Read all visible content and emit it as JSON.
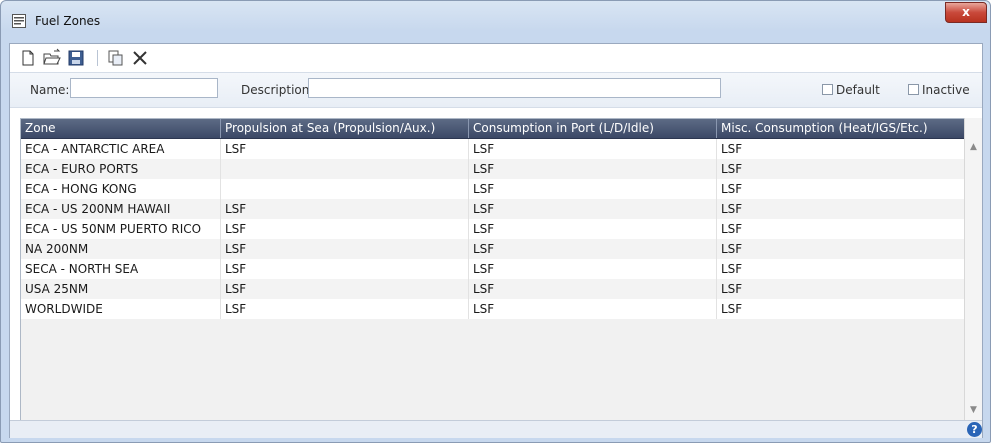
{
  "window": {
    "title": "Fuel Zones",
    "close_label": "x"
  },
  "toolbar": {
    "buttons": [
      {
        "name": "new-document"
      },
      {
        "name": "open-folder"
      },
      {
        "name": "save"
      },
      {
        "name": "copy"
      },
      {
        "name": "delete"
      }
    ]
  },
  "form": {
    "name_label": "Name:",
    "name_value": "",
    "description_label": "Description:",
    "description_value": "",
    "default_label": "Default",
    "inactive_label": "Inactive",
    "default_checked": false,
    "inactive_checked": false
  },
  "grid": {
    "columns": [
      "Zone",
      "Propulsion at Sea (Propulsion/Aux.)",
      "Consumption in Port (L/D/Idle)",
      "Misc. Consumption (Heat/IGS/Etc.)"
    ],
    "rows": [
      [
        "ECA - ANTARCTIC AREA",
        "LSF",
        "LSF",
        "LSF"
      ],
      [
        "ECA - EURO PORTS",
        "",
        "LSF",
        "LSF"
      ],
      [
        "ECA - HONG KONG",
        "",
        "LSF",
        "LSF"
      ],
      [
        "ECA - US 200NM HAWAII",
        "LSF",
        "LSF",
        "LSF"
      ],
      [
        "ECA - US 50NM PUERTO RICO",
        "LSF",
        "LSF",
        "LSF"
      ],
      [
        "NA 200NM",
        "LSF",
        "LSF",
        "LSF"
      ],
      [
        "SECA - NORTH SEA",
        "LSF",
        "LSF",
        "LSF"
      ],
      [
        "USA 25NM",
        "LSF",
        "LSF",
        "LSF"
      ],
      [
        "WORLDWIDE",
        "LSF",
        "LSF",
        "LSF"
      ]
    ]
  },
  "status": {
    "help_label": "?"
  }
}
